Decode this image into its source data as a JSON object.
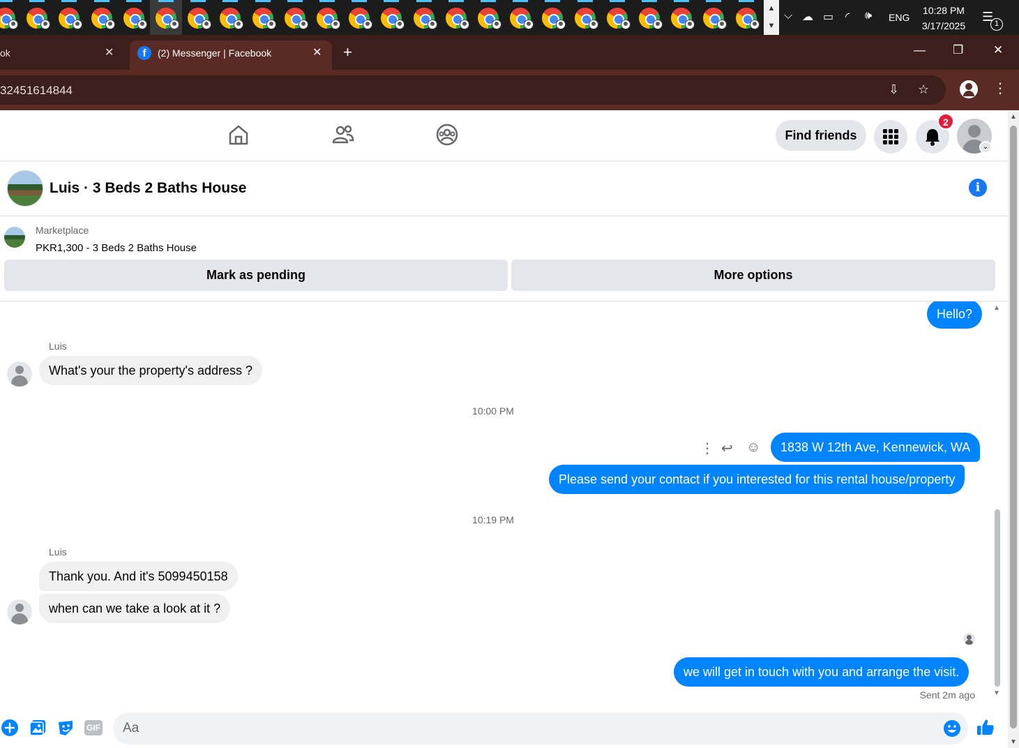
{
  "system_tray": {
    "language": "ENG",
    "time": "10:28 PM",
    "date": "3/17/2025",
    "notification_count": "1"
  },
  "browser": {
    "inactive_tab_title": "ok",
    "active_tab_title": "(2) Messenger | Facebook",
    "url_fragment": "32451614844",
    "new_tab_glyph": "+",
    "close_glyph": "✕"
  },
  "fb_header": {
    "find_friends_label": "Find friends",
    "notification_badge": "2"
  },
  "conversation": {
    "title": "Luis · 3 Beds 2 Baths House"
  },
  "marketplace": {
    "label": "Marketplace",
    "item": "PKR1,300 - 3 Beds 2 Baths House",
    "mark_pending_label": "Mark as pending",
    "more_options_label": "More options"
  },
  "messages": {
    "hello": "Hello?",
    "sender_name_1": "Luis",
    "in_1": "What's your the property's address ?",
    "time_1": "10:00 PM",
    "out_address": "1838 W 12th Ave, Kennewick, WA",
    "out_contact": "Please send your contact if you interested for this rental house/property",
    "time_2": "10:19 PM",
    "sender_name_2": "Luis",
    "in_2": "Thank you. And it's 5099450158",
    "in_3": "when can we take a look at it ?",
    "out_last": "we will get in touch with you and arrange the visit.",
    "sent_status": "Sent 2m ago"
  },
  "composer": {
    "placeholder": "Aa",
    "gif_label": "GIF"
  },
  "colors": {
    "messenger_blue": "#0084ff",
    "facebook_blue": "#1877f2",
    "incoming_bubble": "#f0f0f0",
    "browser_frame": "#3c1e1a",
    "badge_red": "#e41e3f"
  }
}
